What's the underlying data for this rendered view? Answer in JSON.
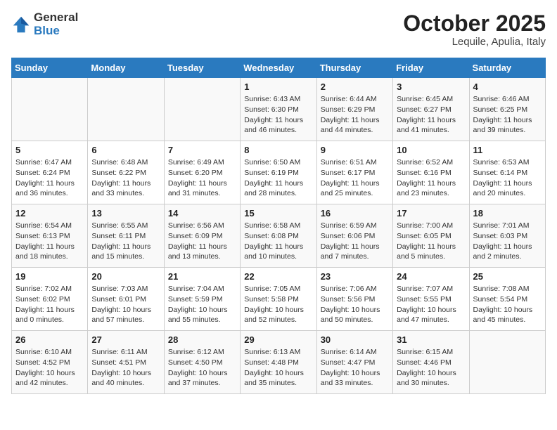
{
  "header": {
    "logo_general": "General",
    "logo_blue": "Blue",
    "month": "October 2025",
    "location": "Lequile, Apulia, Italy"
  },
  "weekdays": [
    "Sunday",
    "Monday",
    "Tuesday",
    "Wednesday",
    "Thursday",
    "Friday",
    "Saturday"
  ],
  "weeks": [
    [
      {
        "num": "",
        "sunrise": "",
        "sunset": "",
        "daylight": ""
      },
      {
        "num": "",
        "sunrise": "",
        "sunset": "",
        "daylight": ""
      },
      {
        "num": "",
        "sunrise": "",
        "sunset": "",
        "daylight": ""
      },
      {
        "num": "1",
        "sunrise": "Sunrise: 6:43 AM",
        "sunset": "Sunset: 6:30 PM",
        "daylight": "Daylight: 11 hours and 46 minutes."
      },
      {
        "num": "2",
        "sunrise": "Sunrise: 6:44 AM",
        "sunset": "Sunset: 6:29 PM",
        "daylight": "Daylight: 11 hours and 44 minutes."
      },
      {
        "num": "3",
        "sunrise": "Sunrise: 6:45 AM",
        "sunset": "Sunset: 6:27 PM",
        "daylight": "Daylight: 11 hours and 41 minutes."
      },
      {
        "num": "4",
        "sunrise": "Sunrise: 6:46 AM",
        "sunset": "Sunset: 6:25 PM",
        "daylight": "Daylight: 11 hours and 39 minutes."
      }
    ],
    [
      {
        "num": "5",
        "sunrise": "Sunrise: 6:47 AM",
        "sunset": "Sunset: 6:24 PM",
        "daylight": "Daylight: 11 hours and 36 minutes."
      },
      {
        "num": "6",
        "sunrise": "Sunrise: 6:48 AM",
        "sunset": "Sunset: 6:22 PM",
        "daylight": "Daylight: 11 hours and 33 minutes."
      },
      {
        "num": "7",
        "sunrise": "Sunrise: 6:49 AM",
        "sunset": "Sunset: 6:20 PM",
        "daylight": "Daylight: 11 hours and 31 minutes."
      },
      {
        "num": "8",
        "sunrise": "Sunrise: 6:50 AM",
        "sunset": "Sunset: 6:19 PM",
        "daylight": "Daylight: 11 hours and 28 minutes."
      },
      {
        "num": "9",
        "sunrise": "Sunrise: 6:51 AM",
        "sunset": "Sunset: 6:17 PM",
        "daylight": "Daylight: 11 hours and 25 minutes."
      },
      {
        "num": "10",
        "sunrise": "Sunrise: 6:52 AM",
        "sunset": "Sunset: 6:16 PM",
        "daylight": "Daylight: 11 hours and 23 minutes."
      },
      {
        "num": "11",
        "sunrise": "Sunrise: 6:53 AM",
        "sunset": "Sunset: 6:14 PM",
        "daylight": "Daylight: 11 hours and 20 minutes."
      }
    ],
    [
      {
        "num": "12",
        "sunrise": "Sunrise: 6:54 AM",
        "sunset": "Sunset: 6:13 PM",
        "daylight": "Daylight: 11 hours and 18 minutes."
      },
      {
        "num": "13",
        "sunrise": "Sunrise: 6:55 AM",
        "sunset": "Sunset: 6:11 PM",
        "daylight": "Daylight: 11 hours and 15 minutes."
      },
      {
        "num": "14",
        "sunrise": "Sunrise: 6:56 AM",
        "sunset": "Sunset: 6:09 PM",
        "daylight": "Daylight: 11 hours and 13 minutes."
      },
      {
        "num": "15",
        "sunrise": "Sunrise: 6:58 AM",
        "sunset": "Sunset: 6:08 PM",
        "daylight": "Daylight: 11 hours and 10 minutes."
      },
      {
        "num": "16",
        "sunrise": "Sunrise: 6:59 AM",
        "sunset": "Sunset: 6:06 PM",
        "daylight": "Daylight: 11 hours and 7 minutes."
      },
      {
        "num": "17",
        "sunrise": "Sunrise: 7:00 AM",
        "sunset": "Sunset: 6:05 PM",
        "daylight": "Daylight: 11 hours and 5 minutes."
      },
      {
        "num": "18",
        "sunrise": "Sunrise: 7:01 AM",
        "sunset": "Sunset: 6:03 PM",
        "daylight": "Daylight: 11 hours and 2 minutes."
      }
    ],
    [
      {
        "num": "19",
        "sunrise": "Sunrise: 7:02 AM",
        "sunset": "Sunset: 6:02 PM",
        "daylight": "Daylight: 11 hours and 0 minutes."
      },
      {
        "num": "20",
        "sunrise": "Sunrise: 7:03 AM",
        "sunset": "Sunset: 6:01 PM",
        "daylight": "Daylight: 10 hours and 57 minutes."
      },
      {
        "num": "21",
        "sunrise": "Sunrise: 7:04 AM",
        "sunset": "Sunset: 5:59 PM",
        "daylight": "Daylight: 10 hours and 55 minutes."
      },
      {
        "num": "22",
        "sunrise": "Sunrise: 7:05 AM",
        "sunset": "Sunset: 5:58 PM",
        "daylight": "Daylight: 10 hours and 52 minutes."
      },
      {
        "num": "23",
        "sunrise": "Sunrise: 7:06 AM",
        "sunset": "Sunset: 5:56 PM",
        "daylight": "Daylight: 10 hours and 50 minutes."
      },
      {
        "num": "24",
        "sunrise": "Sunrise: 7:07 AM",
        "sunset": "Sunset: 5:55 PM",
        "daylight": "Daylight: 10 hours and 47 minutes."
      },
      {
        "num": "25",
        "sunrise": "Sunrise: 7:08 AM",
        "sunset": "Sunset: 5:54 PM",
        "daylight": "Daylight: 10 hours and 45 minutes."
      }
    ],
    [
      {
        "num": "26",
        "sunrise": "Sunrise: 6:10 AM",
        "sunset": "Sunset: 4:52 PM",
        "daylight": "Daylight: 10 hours and 42 minutes."
      },
      {
        "num": "27",
        "sunrise": "Sunrise: 6:11 AM",
        "sunset": "Sunset: 4:51 PM",
        "daylight": "Daylight: 10 hours and 40 minutes."
      },
      {
        "num": "28",
        "sunrise": "Sunrise: 6:12 AM",
        "sunset": "Sunset: 4:50 PM",
        "daylight": "Daylight: 10 hours and 37 minutes."
      },
      {
        "num": "29",
        "sunrise": "Sunrise: 6:13 AM",
        "sunset": "Sunset: 4:48 PM",
        "daylight": "Daylight: 10 hours and 35 minutes."
      },
      {
        "num": "30",
        "sunrise": "Sunrise: 6:14 AM",
        "sunset": "Sunset: 4:47 PM",
        "daylight": "Daylight: 10 hours and 33 minutes."
      },
      {
        "num": "31",
        "sunrise": "Sunrise: 6:15 AM",
        "sunset": "Sunset: 4:46 PM",
        "daylight": "Daylight: 10 hours and 30 minutes."
      },
      {
        "num": "",
        "sunrise": "",
        "sunset": "",
        "daylight": ""
      }
    ]
  ]
}
